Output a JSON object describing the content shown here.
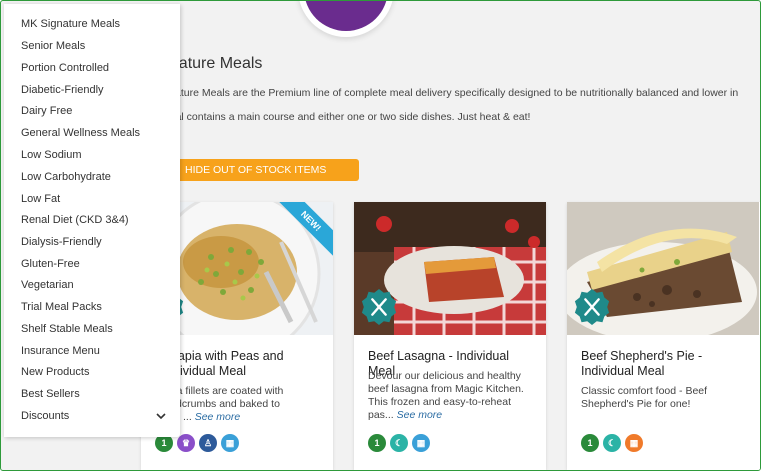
{
  "menu": {
    "items": [
      "MK Signature Meals",
      "Senior Meals",
      "Portion Controlled",
      "Diabetic-Friendly",
      "Dairy Free",
      "General Wellness Meals",
      "Low Sodium",
      "Low Carbohydrate",
      "Low Fat",
      "Renal Diet (CKD 3&4)",
      "Dialysis-Friendly",
      "Gluten-Free",
      "Vegetarian",
      "Trial Meal Packs",
      "Shelf Stable Meals",
      "Insurance Menu",
      "New Products",
      "Best Sellers",
      "Discounts"
    ],
    "chevron_icon": "chevron-down-icon"
  },
  "main": {
    "title": "gnature Meals",
    "description_line1": "ignature Meals are the Premium line of complete meal delivery specifically designed to be nutritionally balanced and lower in",
    "description_line2": "meal contains a main course and either one or two side dishes. Just heat & eat!",
    "hide_button_label": "HIDE OUT OF STOCK ITEMS"
  },
  "products": [
    {
      "name_line1": "d Tilapia with Peas and",
      "name_line2": "- Individual Meal",
      "desc_line1": "tilapia fillets are coated with",
      "desc_line2": "breadcrumbs and baked to",
      "desc_line3": "ction! ...",
      "see_more": "See more",
      "ribbon": "NEW!",
      "badges": [
        "1",
        "crown",
        "person",
        "calendar"
      ]
    },
    {
      "name_line1": "Beef Lasagna - Individual Meal",
      "desc_line1": "Devour our delicious and healthy",
      "desc_line2": "beef lasagna from Magic Kitchen.",
      "desc_line3": "This frozen and easy-to-reheat",
      "desc_line4": "pas...",
      "see_more": "See more",
      "badges": [
        "1",
        "leaf",
        "calendar"
      ]
    },
    {
      "name_line1": "Beef Shepherd's Pie -",
      "name_line2": "Individual Meal",
      "desc_line1": "Classic comfort food - Beef",
      "desc_line2": "Shepherd's Pie for one!",
      "badges": [
        "1",
        "leaf",
        "calendar"
      ]
    }
  ],
  "colors": {
    "accent_orange": "#f7a21b",
    "brand_purple": "#6a2c8e",
    "badge_teal": "#1f8a8a",
    "link_blue": "#2b6ca3",
    "frame_green": "#2e9a3a"
  }
}
